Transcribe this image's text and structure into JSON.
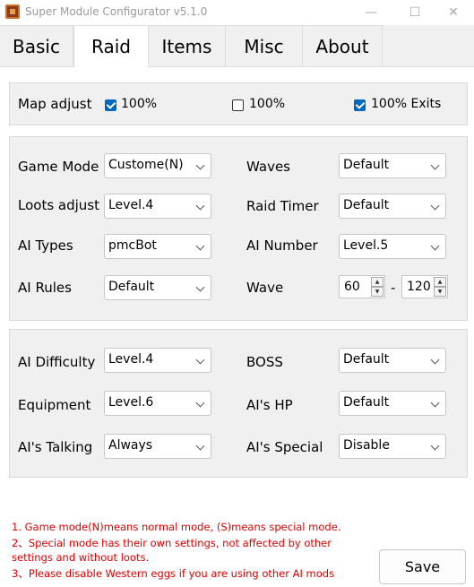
{
  "window": {
    "title": "Super Module Configurator v5.1.0",
    "controls": {
      "minimize": "—",
      "maximize": "☐",
      "close": "✕"
    }
  },
  "tabs": [
    "Basic",
    "Raid",
    "Items",
    "Misc",
    "About"
  ],
  "active_tab": "Raid",
  "map_adjust": {
    "label": "Map adjust",
    "options": [
      {
        "label": "100%",
        "checked": true
      },
      {
        "label": "100%",
        "checked": false
      },
      {
        "label": "100% Exits",
        "checked": true
      }
    ]
  },
  "raid_settings": {
    "game_mode": {
      "label": "Game Mode",
      "value": "Custome(N)"
    },
    "waves": {
      "label": "Waves",
      "value": "Default"
    },
    "loots_adjust": {
      "label": "Loots adjust",
      "value": "Level.4"
    },
    "raid_timer": {
      "label": "Raid Timer",
      "value": "Default"
    },
    "ai_types": {
      "label": "AI Types",
      "value": "pmcBot"
    },
    "ai_number": {
      "label": "AI Number",
      "value": "Level.5"
    },
    "ai_rules": {
      "label": "AI Rules",
      "value": "Default"
    },
    "wave": {
      "label": "Wave",
      "min": "60",
      "separator": "-",
      "max": "120"
    }
  },
  "ai_settings": {
    "ai_difficulty": {
      "label": "AI Difficulty",
      "value": "Level.4"
    },
    "boss": {
      "label": "BOSS",
      "value": "Default"
    },
    "equipment": {
      "label": "Equipment",
      "value": "Level.6"
    },
    "ai_hp": {
      "label": "AI's HP",
      "value": "Default"
    },
    "ai_talking": {
      "label": "AI's Talking",
      "value": "Always"
    },
    "ai_special": {
      "label": "AI's Special",
      "value": "Disable"
    }
  },
  "notes": [
    "1. Game mode(N)means normal mode, (S)means special mode.",
    "2、Special mode has their own settings, not affected by other",
    "settings and without loots.",
    "3、Please disable Western eggs if you are using other AI mods"
  ],
  "save_label": "Save",
  "colors": {
    "accent": "#0067c0",
    "note_text": "#e00000"
  }
}
